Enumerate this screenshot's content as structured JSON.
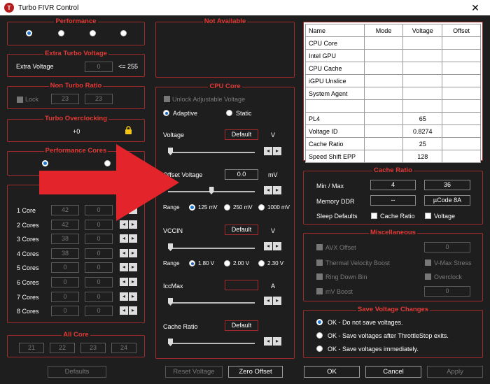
{
  "window": {
    "title": "Turbo FIVR Control",
    "icon_letter": "T",
    "close": "✕"
  },
  "performance": {
    "title": "Performance",
    "selected": 0,
    "count": 4
  },
  "not_available": {
    "title": "Not Available"
  },
  "extra_turbo": {
    "title": "Extra Turbo Voltage",
    "label": "Extra Voltage",
    "value": "0",
    "note": "<= 255"
  },
  "non_turbo": {
    "title": "Non Turbo Ratio",
    "lock": "Lock",
    "v1": "23",
    "v2": "23"
  },
  "turbo_oc": {
    "title": "Turbo Overclocking",
    "value": "+0"
  },
  "perf_cores": {
    "title": "Performance Cores"
  },
  "cores": [
    {
      "label": "1 Core",
      "a": "42",
      "b": "0"
    },
    {
      "label": "2 Cores",
      "a": "42",
      "b": "0"
    },
    {
      "label": "3 Cores",
      "a": "38",
      "b": "0"
    },
    {
      "label": "4 Cores",
      "a": "38",
      "b": "0"
    },
    {
      "label": "5 Cores",
      "a": "0",
      "b": "0"
    },
    {
      "label": "6 Cores",
      "a": "0",
      "b": "0"
    },
    {
      "label": "7 Cores",
      "a": "0",
      "b": "0"
    },
    {
      "label": "8 Cores",
      "a": "0",
      "b": "0"
    }
  ],
  "all_core": {
    "title": "All Core",
    "values": [
      "21",
      "22",
      "23",
      "24"
    ]
  },
  "cpu_core": {
    "title": "CPU Core",
    "unlock": "Unlock Adjustable Voltage",
    "adaptive": "Adaptive",
    "static": "Static",
    "voltage": {
      "label": "Voltage",
      "value": "Default",
      "unit": "V"
    },
    "offset": {
      "label": "Offset Voltage",
      "value": "0.0",
      "unit": "mV",
      "position": 0.5
    },
    "range_label": "Range",
    "ranges": [
      "125 mV",
      "250 mV",
      "1000 mV"
    ],
    "vccin": {
      "label": "VCCIN",
      "value": "Default",
      "unit": "V"
    },
    "vranges": [
      "1.80 V",
      "2.00 V",
      "2.30 V"
    ],
    "iccmax": {
      "label": "IccMax",
      "value": "",
      "unit": "A"
    },
    "cache_ratio": {
      "label": "Cache Ratio",
      "value": "Default"
    }
  },
  "table": {
    "headers": [
      "Name",
      "Mode",
      "Voltage",
      "Offset"
    ],
    "rows": [
      [
        "CPU Core",
        "",
        "",
        ""
      ],
      [
        "Intel GPU",
        "",
        "",
        ""
      ],
      [
        "CPU Cache",
        "",
        "",
        ""
      ],
      [
        "iGPU Unslice",
        "",
        "",
        ""
      ],
      [
        "System Agent",
        "",
        "",
        ""
      ],
      [
        "",
        "",
        "",
        ""
      ],
      [
        "PL4",
        "",
        "65",
        ""
      ],
      [
        "Voltage ID",
        "",
        "0.8274",
        ""
      ],
      [
        "Cache Ratio",
        "",
        "25",
        ""
      ],
      [
        "Speed Shift EPP",
        "",
        "128",
        ""
      ]
    ]
  },
  "cache_ratio_box": {
    "title": "Cache Ratio",
    "minmax_label": "Min / Max",
    "min": "4",
    "max": "36",
    "memory_label": "Memory DDR",
    "memory": "--",
    "ucode": "µCode  8A",
    "sleep_label": "Sleep Defaults",
    "sleep_cache": "Cache Ratio",
    "sleep_voltage": "Voltage"
  },
  "misc": {
    "title": "Miscellaneous",
    "avx": "AVX Offset",
    "avx_value": "0",
    "tvb": "Thermal Velocity Boost",
    "vmax": "V-Max Stress",
    "rdb": "Ring Down Bin",
    "overclock": "Overclock",
    "mv": "mV Boost",
    "mv_value": "0"
  },
  "save": {
    "title": "Save Voltage Changes",
    "options": [
      "OK - Do not save voltages.",
      "OK - Save voltages after ThrottleStop exits.",
      "OK - Save voltages immediately."
    ]
  },
  "buttons": {
    "defaults": "Defaults",
    "reset_voltage": "Reset Voltage",
    "zero_offset": "Zero Offset",
    "ok": "OK",
    "cancel": "Cancel",
    "apply": "Apply"
  },
  "colors": {
    "accent_red": "#e53935",
    "arrow_red": "#e3242b",
    "border_red": "#a32a2a"
  }
}
